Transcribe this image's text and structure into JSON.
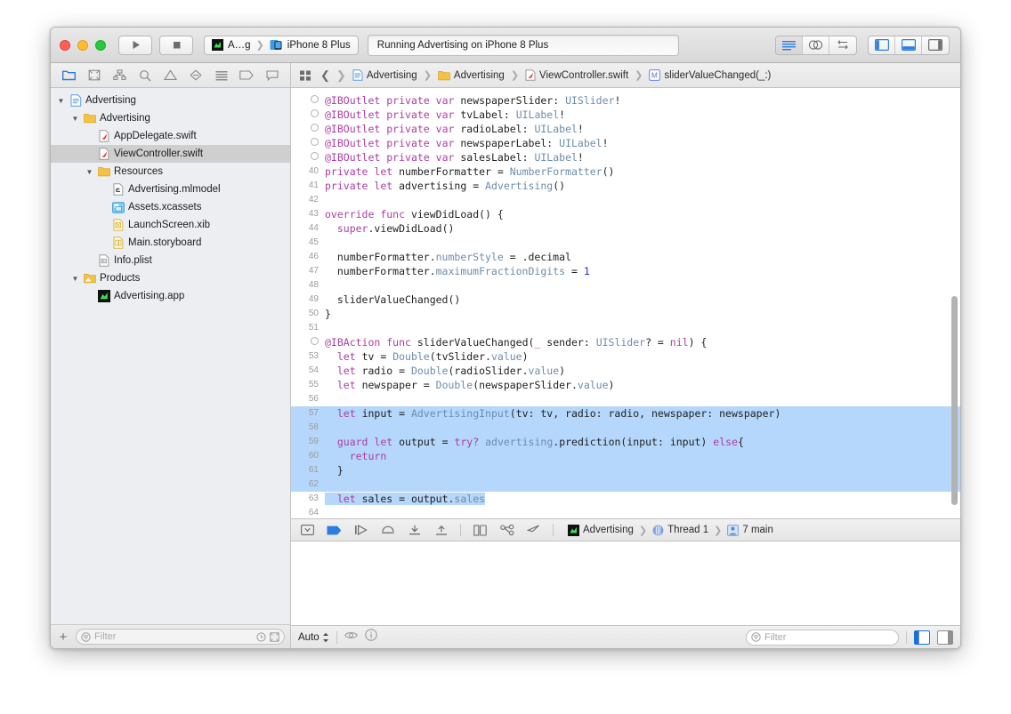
{
  "titlebar": {
    "run_icon": "play-icon",
    "stop_icon": "stop-icon",
    "scheme_name": "A…g",
    "scheme_icon": "app-icon",
    "device_name": "iPhone 8 Plus",
    "device_icon": "simulator-icon",
    "status_text": "Running Advertising on iPhone 8 Plus",
    "editor_modes": [
      "standard-editor-icon",
      "assistant-editor-icon",
      "version-editor-icon"
    ],
    "view_toggles": [
      "navigator-toggle-icon",
      "debug-area-toggle-icon",
      "utilities-toggle-icon"
    ]
  },
  "navigator_tabs": [
    "project-navigator-icon",
    "source-control-navigator-icon",
    "symbol-navigator-icon",
    "find-navigator-icon",
    "issue-navigator-icon",
    "test-navigator-icon",
    "debug-navigator-icon",
    "breakpoint-navigator-icon",
    "report-navigator-icon"
  ],
  "jumpbar": {
    "back_icon": "chevron-left-icon",
    "forward_icon": "chevron-right-icon",
    "related_icon": "related-items-icon",
    "crumbs": [
      {
        "label": "Advertising",
        "icon": "project-file-icon"
      },
      {
        "label": "Advertising",
        "icon": "folder-icon"
      },
      {
        "label": "ViewController.swift",
        "icon": "swift-file-icon"
      },
      {
        "label": "sliderValueChanged(_:)",
        "icon": "method-icon"
      }
    ]
  },
  "navigator": {
    "tree": [
      {
        "label": "Advertising",
        "indent": 0,
        "icon": "project-icon",
        "disclosure": "open",
        "selected": false
      },
      {
        "label": "Advertising",
        "indent": 1,
        "icon": "folder-icon",
        "disclosure": "open",
        "selected": false
      },
      {
        "label": "AppDelegate.swift",
        "indent": 2,
        "icon": "swift-file-icon",
        "disclosure": "none",
        "selected": false
      },
      {
        "label": "ViewController.swift",
        "indent": 2,
        "icon": "swift-file-icon",
        "disclosure": "none",
        "selected": true
      },
      {
        "label": "Resources",
        "indent": 2,
        "icon": "folder-icon",
        "disclosure": "open",
        "selected": false
      },
      {
        "label": "Advertising.mlmodel",
        "indent": 3,
        "icon": "mlmodel-icon",
        "disclosure": "none",
        "selected": false
      },
      {
        "label": "Assets.xcassets",
        "indent": 3,
        "icon": "assets-icon",
        "disclosure": "none",
        "selected": false
      },
      {
        "label": "LaunchScreen.xib",
        "indent": 3,
        "icon": "xib-icon",
        "disclosure": "none",
        "selected": false
      },
      {
        "label": "Main.storyboard",
        "indent": 3,
        "icon": "storyboard-icon",
        "disclosure": "none",
        "selected": false
      },
      {
        "label": "Info.plist",
        "indent": 2,
        "icon": "plist-icon",
        "disclosure": "none",
        "selected": false
      },
      {
        "label": "Products",
        "indent": 1,
        "icon": "products-icon",
        "disclosure": "open",
        "selected": false
      },
      {
        "label": "Advertising.app",
        "indent": 2,
        "icon": "app-icon",
        "disclosure": "none",
        "selected": false
      }
    ],
    "footer": {
      "add_label": "+",
      "filter_placeholder": "Filter",
      "filter_icon": "filter-icon",
      "recent_icon": "clock-icon",
      "scm_icon": "source-control-icon"
    }
  },
  "editor": {
    "lines": [
      {
        "num": "",
        "marker": true,
        "selected": false,
        "tokens": [
          {
            "t": "@IBOutlet",
            "c": "at"
          },
          {
            "t": " ",
            "c": ""
          },
          {
            "t": "private",
            "c": "kw"
          },
          {
            "t": " ",
            "c": ""
          },
          {
            "t": "var",
            "c": "kw"
          },
          {
            "t": " newspaperSlider: ",
            "c": ""
          },
          {
            "t": "UISlider",
            "c": "ty"
          },
          {
            "t": "!",
            "c": ""
          }
        ]
      },
      {
        "num": "",
        "marker": true,
        "selected": false,
        "tokens": [
          {
            "t": "@IBOutlet",
            "c": "at"
          },
          {
            "t": " ",
            "c": ""
          },
          {
            "t": "private",
            "c": "kw"
          },
          {
            "t": " ",
            "c": ""
          },
          {
            "t": "var",
            "c": "kw"
          },
          {
            "t": " tvLabel: ",
            "c": ""
          },
          {
            "t": "UILabel",
            "c": "ty"
          },
          {
            "t": "!",
            "c": ""
          }
        ]
      },
      {
        "num": "",
        "marker": true,
        "selected": false,
        "tokens": [
          {
            "t": "@IBOutlet",
            "c": "at"
          },
          {
            "t": " ",
            "c": ""
          },
          {
            "t": "private",
            "c": "kw"
          },
          {
            "t": " ",
            "c": ""
          },
          {
            "t": "var",
            "c": "kw"
          },
          {
            "t": " radioLabel: ",
            "c": ""
          },
          {
            "t": "UILabel",
            "c": "ty"
          },
          {
            "t": "!",
            "c": ""
          }
        ]
      },
      {
        "num": "",
        "marker": true,
        "selected": false,
        "tokens": [
          {
            "t": "@IBOutlet",
            "c": "at"
          },
          {
            "t": " ",
            "c": ""
          },
          {
            "t": "private",
            "c": "kw"
          },
          {
            "t": " ",
            "c": ""
          },
          {
            "t": "var",
            "c": "kw"
          },
          {
            "t": " newspaperLabel: ",
            "c": ""
          },
          {
            "t": "UILabel",
            "c": "ty"
          },
          {
            "t": "!",
            "c": ""
          }
        ]
      },
      {
        "num": "",
        "marker": true,
        "selected": false,
        "tokens": [
          {
            "t": "@IBOutlet",
            "c": "at"
          },
          {
            "t": " ",
            "c": ""
          },
          {
            "t": "private",
            "c": "kw"
          },
          {
            "t": " ",
            "c": ""
          },
          {
            "t": "var",
            "c": "kw"
          },
          {
            "t": " salesLabel: ",
            "c": ""
          },
          {
            "t": "UILabel",
            "c": "ty"
          },
          {
            "t": "!",
            "c": ""
          }
        ]
      },
      {
        "num": "40",
        "marker": false,
        "selected": false,
        "tokens": [
          {
            "t": "private",
            "c": "kw"
          },
          {
            "t": " ",
            "c": ""
          },
          {
            "t": "let",
            "c": "kw"
          },
          {
            "t": " numberFormatter = ",
            "c": ""
          },
          {
            "t": "NumberFormatter",
            "c": "ty"
          },
          {
            "t": "()",
            "c": ""
          }
        ]
      },
      {
        "num": "41",
        "marker": false,
        "selected": false,
        "tokens": [
          {
            "t": "private",
            "c": "kw"
          },
          {
            "t": " ",
            "c": ""
          },
          {
            "t": "let",
            "c": "kw"
          },
          {
            "t": " advertising = ",
            "c": ""
          },
          {
            "t": "Advertising",
            "c": "ty"
          },
          {
            "t": "()",
            "c": ""
          }
        ]
      },
      {
        "num": "42",
        "marker": false,
        "selected": false,
        "tokens": []
      },
      {
        "num": "43",
        "marker": false,
        "selected": false,
        "tokens": [
          {
            "t": "override",
            "c": "kw"
          },
          {
            "t": " ",
            "c": ""
          },
          {
            "t": "func",
            "c": "kw"
          },
          {
            "t": " viewDidLoad() {",
            "c": ""
          }
        ]
      },
      {
        "num": "44",
        "marker": false,
        "selected": false,
        "tokens": [
          {
            "t": "  ",
            "c": ""
          },
          {
            "t": "super",
            "c": "kw"
          },
          {
            "t": ".viewDidLoad()",
            "c": ""
          }
        ]
      },
      {
        "num": "45",
        "marker": false,
        "selected": false,
        "tokens": []
      },
      {
        "num": "46",
        "marker": false,
        "selected": false,
        "tokens": [
          {
            "t": "  numberFormatter.",
            "c": ""
          },
          {
            "t": "numberStyle",
            "c": "ty"
          },
          {
            "t": " = .decimal",
            "c": ""
          }
        ]
      },
      {
        "num": "47",
        "marker": false,
        "selected": false,
        "tokens": [
          {
            "t": "  numberFormatter.",
            "c": ""
          },
          {
            "t": "maximumFractionDigits",
            "c": "ty"
          },
          {
            "t": " = ",
            "c": ""
          },
          {
            "t": "1",
            "c": "num"
          }
        ]
      },
      {
        "num": "48",
        "marker": false,
        "selected": false,
        "tokens": []
      },
      {
        "num": "49",
        "marker": false,
        "selected": false,
        "tokens": [
          {
            "t": "  sliderValueChanged()",
            "c": ""
          }
        ]
      },
      {
        "num": "50",
        "marker": false,
        "selected": false,
        "tokens": [
          {
            "t": "}",
            "c": ""
          }
        ]
      },
      {
        "num": "51",
        "marker": false,
        "selected": false,
        "tokens": []
      },
      {
        "num": "",
        "marker": true,
        "selected": false,
        "tokens": [
          {
            "t": "@IBAction",
            "c": "at"
          },
          {
            "t": " ",
            "c": ""
          },
          {
            "t": "func",
            "c": "kw"
          },
          {
            "t": " sliderValueChanged(",
            "c": ""
          },
          {
            "t": "_",
            "c": "kw"
          },
          {
            "t": " sender: ",
            "c": ""
          },
          {
            "t": "UISlider",
            "c": "ty"
          },
          {
            "t": "? = ",
            "c": ""
          },
          {
            "t": "nil",
            "c": "kw"
          },
          {
            "t": ") {",
            "c": ""
          }
        ]
      },
      {
        "num": "53",
        "marker": false,
        "selected": false,
        "tokens": [
          {
            "t": "  ",
            "c": ""
          },
          {
            "t": "let",
            "c": "kw"
          },
          {
            "t": " tv = ",
            "c": ""
          },
          {
            "t": "Double",
            "c": "ty"
          },
          {
            "t": "(tvSlider.",
            "c": ""
          },
          {
            "t": "value",
            "c": "ty"
          },
          {
            "t": ")",
            "c": ""
          }
        ]
      },
      {
        "num": "54",
        "marker": false,
        "selected": false,
        "tokens": [
          {
            "t": "  ",
            "c": ""
          },
          {
            "t": "let",
            "c": "kw"
          },
          {
            "t": " radio = ",
            "c": ""
          },
          {
            "t": "Double",
            "c": "ty"
          },
          {
            "t": "(radioSlider.",
            "c": ""
          },
          {
            "t": "value",
            "c": "ty"
          },
          {
            "t": ")",
            "c": ""
          }
        ]
      },
      {
        "num": "55",
        "marker": false,
        "selected": false,
        "tokens": [
          {
            "t": "  ",
            "c": ""
          },
          {
            "t": "let",
            "c": "kw"
          },
          {
            "t": " newspaper = ",
            "c": ""
          },
          {
            "t": "Double",
            "c": "ty"
          },
          {
            "t": "(newspaperSlider.",
            "c": ""
          },
          {
            "t": "value",
            "c": "ty"
          },
          {
            "t": ")",
            "c": ""
          }
        ]
      },
      {
        "num": "56",
        "marker": false,
        "selected": false,
        "tokens": []
      },
      {
        "num": "57",
        "marker": false,
        "selected": true,
        "tokens": [
          {
            "t": "  ",
            "c": ""
          },
          {
            "t": "let",
            "c": "kw"
          },
          {
            "t": " input = ",
            "c": ""
          },
          {
            "t": "AdvertisingInput",
            "c": "ty"
          },
          {
            "t": "(tv: tv, radio: radio, newspaper: newspaper)",
            "c": ""
          }
        ]
      },
      {
        "num": "58",
        "marker": false,
        "selected": true,
        "tokens": []
      },
      {
        "num": "59",
        "marker": false,
        "selected": true,
        "tokens": [
          {
            "t": "  ",
            "c": ""
          },
          {
            "t": "guard",
            "c": "kw"
          },
          {
            "t": " ",
            "c": ""
          },
          {
            "t": "let",
            "c": "kw"
          },
          {
            "t": " output = ",
            "c": ""
          },
          {
            "t": "try?",
            "c": "kw"
          },
          {
            "t": " ",
            "c": ""
          },
          {
            "t": "advertising",
            "c": "ty"
          },
          {
            "t": ".prediction(input: input) ",
            "c": ""
          },
          {
            "t": "else",
            "c": "kw"
          },
          {
            "t": "{",
            "c": ""
          }
        ]
      },
      {
        "num": "60",
        "marker": false,
        "selected": true,
        "tokens": [
          {
            "t": "    ",
            "c": ""
          },
          {
            "t": "return",
            "c": "kw"
          }
        ]
      },
      {
        "num": "61",
        "marker": false,
        "selected": true,
        "tokens": [
          {
            "t": "  }",
            "c": ""
          }
        ]
      },
      {
        "num": "62",
        "marker": false,
        "selected": true,
        "tokens": []
      },
      {
        "num": "63",
        "marker": false,
        "selected": "partial",
        "tokens": [
          {
            "t": "  ",
            "c": ""
          },
          {
            "t": "let",
            "c": "kw"
          },
          {
            "t": " sales = output.",
            "c": ""
          },
          {
            "t": "sales",
            "c": "ty"
          }
        ]
      },
      {
        "num": "64",
        "marker": false,
        "selected": false,
        "tokens": []
      }
    ]
  },
  "debugbar": {
    "icons": [
      "hide-debug-area-icon",
      "deactivate-breakpoints-icon",
      "continue-icon",
      "step-over-icon",
      "step-into-icon",
      "step-out-icon",
      "debug-view-hierarchy-icon",
      "memory-graph-icon",
      "simulate-location-icon"
    ],
    "crumbs": [
      {
        "label": "Advertising",
        "icon": "app-icon"
      },
      {
        "label": "Thread 1",
        "icon": "thread-icon"
      },
      {
        "label": "7 main",
        "icon": "frame-icon"
      }
    ]
  },
  "statusbar": {
    "auto_label": "Auto",
    "stepper_icon": "updown-stepper-icon",
    "eye_icon": "eye-icon",
    "info_icon": "info-icon",
    "filter_placeholder": "Filter",
    "filter_icon": "filter-icon",
    "variables_toggle_icon": "variables-view-toggle-icon",
    "console_toggle_icon": "console-view-toggle-icon"
  }
}
